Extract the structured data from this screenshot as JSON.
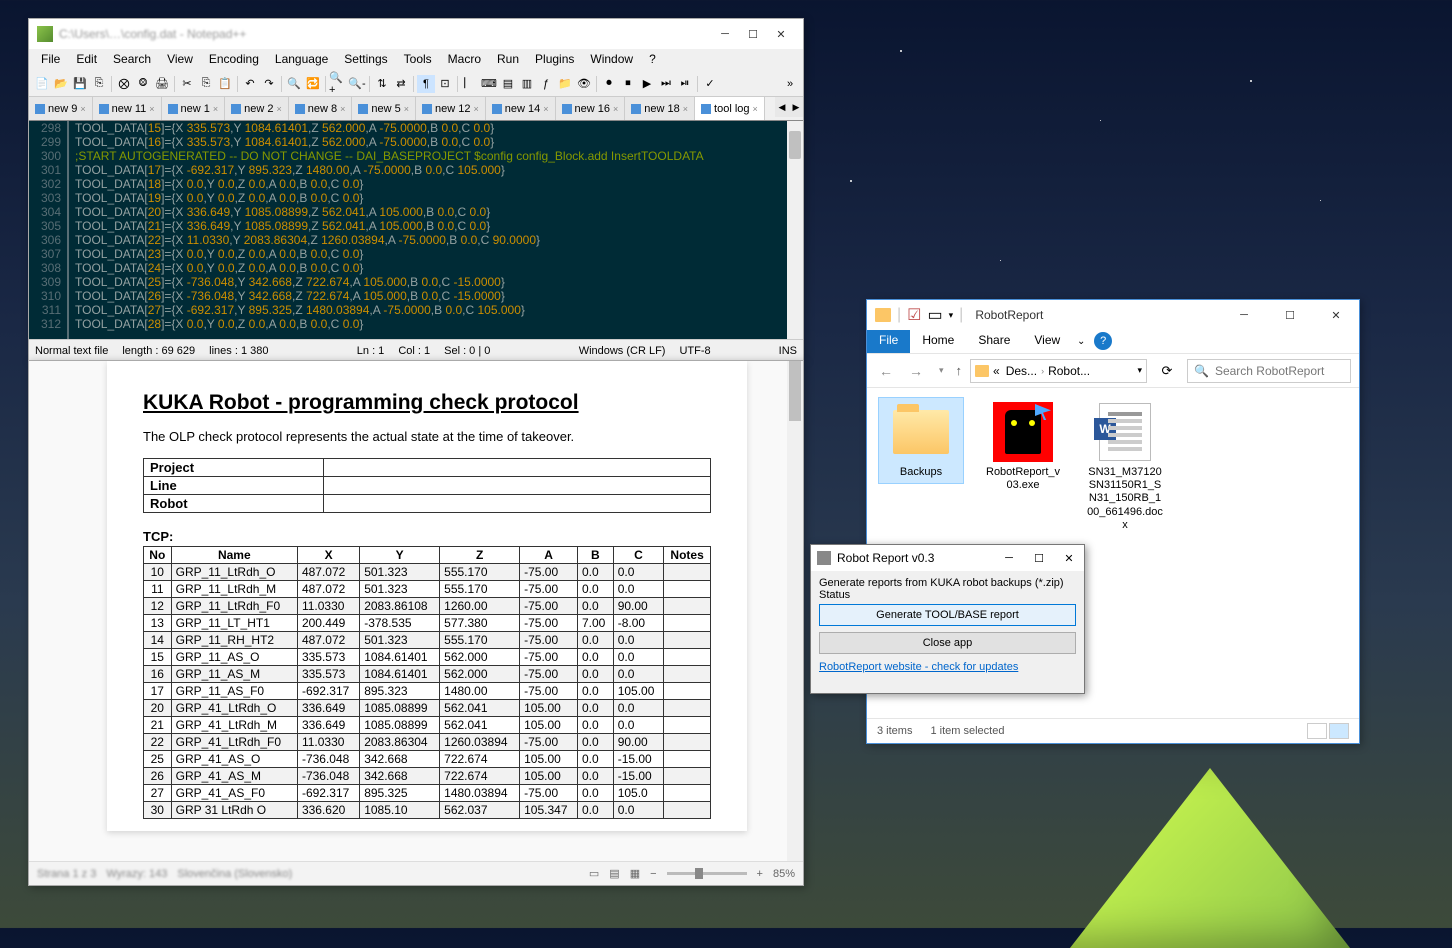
{
  "npp": {
    "title": "C:\\Users\\…\\config.dat - Notepad++",
    "menus": [
      "File",
      "Edit",
      "Search",
      "View",
      "Encoding",
      "Language",
      "Settings",
      "Tools",
      "Macro",
      "Run",
      "Plugins",
      "Window",
      "?"
    ],
    "tabs": [
      "new 9",
      "new 11",
      "new 1",
      "new 2",
      "new 8",
      "new 5",
      "new 12",
      "new 14",
      "new 16",
      "new 18",
      "tool log"
    ],
    "lines": [
      {
        "n": 298,
        "t": "TOOL_DATA[15]={X 335.573,Y 1084.61401,Z 562.000,A -75.0000,B 0.0,C 0.0}"
      },
      {
        "n": 299,
        "t": "TOOL_DATA[16]={X 335.573,Y 1084.61401,Z 562.000,A -75.0000,B 0.0,C 0.0}"
      },
      {
        "n": 300,
        "t": ";START AUTOGENERATED -- DO NOT CHANGE -- DAI_BASEPROJECT $config config_Block.add InsertTOOLDATA"
      },
      {
        "n": 301,
        "t": "TOOL_DATA[17]={X -692.317,Y 895.323,Z 1480.00,A -75.0000,B 0.0,C 105.000}"
      },
      {
        "n": 302,
        "t": "TOOL_DATA[18]={X 0.0,Y 0.0,Z 0.0,A 0.0,B 0.0,C 0.0}"
      },
      {
        "n": 303,
        "t": "TOOL_DATA[19]={X 0.0,Y 0.0,Z 0.0,A 0.0,B 0.0,C 0.0}"
      },
      {
        "n": 304,
        "t": "TOOL_DATA[20]={X 336.649,Y 1085.08899,Z 562.041,A 105.000,B 0.0,C 0.0}"
      },
      {
        "n": 305,
        "t": "TOOL_DATA[21]={X 336.649,Y 1085.08899,Z 562.041,A 105.000,B 0.0,C 0.0}"
      },
      {
        "n": 306,
        "t": "TOOL_DATA[22]={X 11.0330,Y 2083.86304,Z 1260.03894,A -75.0000,B 0.0,C 90.0000}"
      },
      {
        "n": 307,
        "t": "TOOL_DATA[23]={X 0.0,Y 0.0,Z 0.0,A 0.0,B 0.0,C 0.0}"
      },
      {
        "n": 308,
        "t": "TOOL_DATA[24]={X 0.0,Y 0.0,Z 0.0,A 0.0,B 0.0,C 0.0}"
      },
      {
        "n": 309,
        "t": "TOOL_DATA[25]={X -736.048,Y 342.668,Z 722.674,A 105.000,B 0.0,C -15.0000}"
      },
      {
        "n": 310,
        "t": "TOOL_DATA[26]={X -736.048,Y 342.668,Z 722.674,A 105.000,B 0.0,C -15.0000}"
      },
      {
        "n": 311,
        "t": "TOOL_DATA[27]={X -692.317,Y 895.325,Z 1480.03894,A -75.0000,B 0.0,C 105.000}"
      },
      {
        "n": 312,
        "t": "TOOL_DATA[28]={X 0.0,Y 0.0,Z 0.0,A 0.0,B 0.0,C 0.0}"
      }
    ],
    "status": {
      "type": "Normal text file",
      "length": "length : 69 629",
      "lines": "lines : 1 380",
      "ln": "Ln : 1",
      "col": "Col : 1",
      "sel": "Sel : 0 | 0",
      "eol": "Windows (CR LF)",
      "enc": "UTF-8",
      "ins": "INS"
    }
  },
  "doc": {
    "h1": "KUKA Robot - programming check protocol",
    "intro": "The OLP check protocol represents the actual state at the time of takeover.",
    "project_rows": [
      "Project",
      "Line",
      "Robot"
    ],
    "tcp_label": "TCP:",
    "tcp_headers": [
      "No",
      "Name",
      "X",
      "Y",
      "Z",
      "A",
      "B",
      "C",
      "Notes"
    ],
    "tcp_rows": [
      [
        "10",
        "GRP_11_LtRdh_O",
        "487.072",
        "501.323",
        "555.170",
        "-75.00",
        "0.0",
        "0.0",
        ""
      ],
      [
        "11",
        "GRP_11_LtRdh_M",
        "487.072",
        "501.323",
        "555.170",
        "-75.00",
        "0.0",
        "0.0",
        ""
      ],
      [
        "12",
        "GRP_11_LtRdh_F0",
        "11.0330",
        "2083.86108",
        "1260.00",
        "-75.00",
        "0.0",
        "90.00",
        ""
      ],
      [
        "13",
        "GRP_11_LT_HT1",
        "200.449",
        "-378.535",
        "577.380",
        "-75.00",
        "7.00",
        "-8.00",
        ""
      ],
      [
        "14",
        "GRP_11_RH_HT2",
        "487.072",
        "501.323",
        "555.170",
        "-75.00",
        "0.0",
        "0.0",
        ""
      ],
      [
        "15",
        "GRP_11_AS_O",
        "335.573",
        "1084.61401",
        "562.000",
        "-75.00",
        "0.0",
        "0.0",
        ""
      ],
      [
        "16",
        "GRP_11_AS_M",
        "335.573",
        "1084.61401",
        "562.000",
        "-75.00",
        "0.0",
        "0.0",
        ""
      ],
      [
        "17",
        "GRP_11_AS_F0",
        "-692.317",
        "895.323",
        "1480.00",
        "-75.00",
        "0.0",
        "105.00",
        ""
      ],
      [
        "20",
        "GRP_41_LtRdh_O",
        "336.649",
        "1085.08899",
        "562.041",
        "105.00",
        "0.0",
        "0.0",
        ""
      ],
      [
        "21",
        "GRP_41_LtRdh_M",
        "336.649",
        "1085.08899",
        "562.041",
        "105.00",
        "0.0",
        "0.0",
        ""
      ],
      [
        "22",
        "GRP_41_LtRdh_F0",
        "11.0330",
        "2083.86304",
        "1260.03894",
        "-75.00",
        "0.0",
        "90.00",
        ""
      ],
      [
        "25",
        "GRP_41_AS_O",
        "-736.048",
        "342.668",
        "722.674",
        "105.00",
        "0.0",
        "-15.00",
        ""
      ],
      [
        "26",
        "GRP_41_AS_M",
        "-736.048",
        "342.668",
        "722.674",
        "105.00",
        "0.0",
        "-15.00",
        ""
      ],
      [
        "27",
        "GRP_41_AS_F0",
        "-692.317",
        "895.325",
        "1480.03894",
        "-75.00",
        "0.0",
        "105.0",
        ""
      ],
      [
        "30",
        "GRP 31 LtRdh O",
        "336.620",
        "1085.10",
        "562.037",
        "105.347",
        "0.0",
        "0.0",
        ""
      ]
    ],
    "zoom": "85%"
  },
  "exp": {
    "title": "RobotReport",
    "ribbon": [
      "File",
      "Home",
      "Share",
      "View"
    ],
    "crumbs": [
      "«",
      "Des...",
      "Robot..."
    ],
    "search_placeholder": "Search RobotReport",
    "items": [
      {
        "name": "Backups",
        "type": "folder",
        "selected": true
      },
      {
        "name": "RobotReport_v03.exe",
        "type": "exe"
      },
      {
        "name": "SN31_M37120SN31150R1_SN31_150RB_100_661496.docx",
        "type": "word"
      }
    ],
    "status": {
      "count": "3 items",
      "selected": "1 item selected"
    }
  },
  "rr": {
    "title": "Robot Report v0.3",
    "desc": "Generate reports from KUKA robot backups (*.zip)",
    "status_label": "Status",
    "btn_generate": "Generate TOOL/BASE report",
    "btn_close": "Close app",
    "link": "RobotReport website - check for updates"
  }
}
